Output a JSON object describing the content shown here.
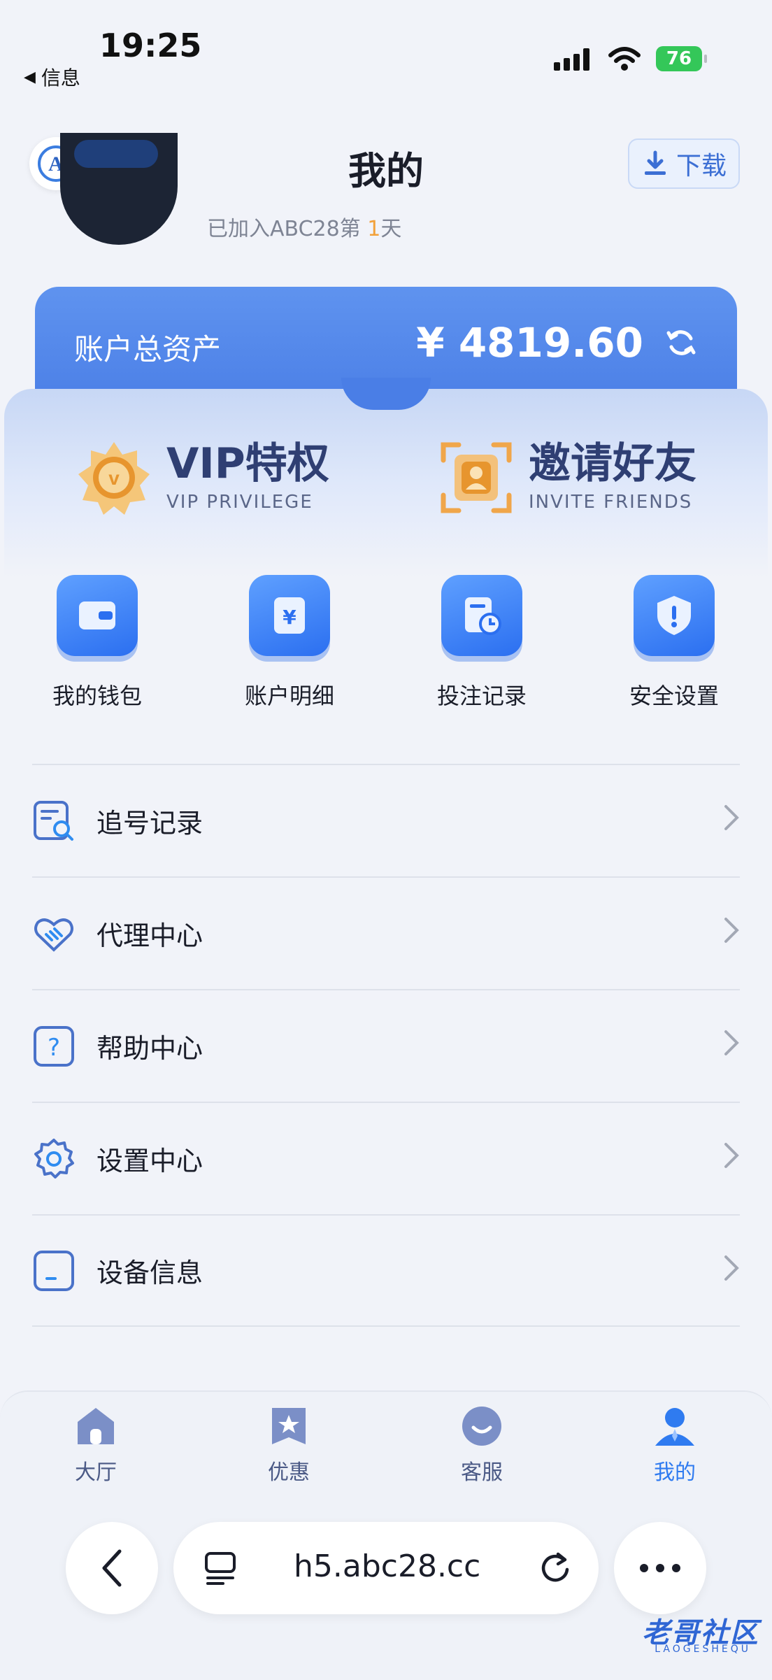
{
  "status_bar": {
    "time": "19:25",
    "back_app": "信息",
    "battery": "76"
  },
  "header": {
    "title": "我的",
    "download_label": "下载"
  },
  "profile": {
    "join_prefix": "已加入ABC28第 ",
    "join_days": "1",
    "join_suffix": "天"
  },
  "asset": {
    "label": "账户总资产",
    "value": "¥ 4819.60"
  },
  "privileges": [
    {
      "title": "VIP特权",
      "subtitle": "VIP PRIVILEGE"
    },
    {
      "title": "邀请好友",
      "subtitle": "INVITE FRIENDS"
    }
  ],
  "quick_actions": [
    {
      "label": "我的钱包",
      "icon": "wallet-icon"
    },
    {
      "label": "账户明细",
      "icon": "bill-icon"
    },
    {
      "label": "投注记录",
      "icon": "record-icon"
    },
    {
      "label": "安全设置",
      "icon": "shield-icon"
    }
  ],
  "menu": [
    {
      "label": "追号记录",
      "icon": "search-record-icon"
    },
    {
      "label": "代理中心",
      "icon": "handshake-heart-icon"
    },
    {
      "label": "帮助中心",
      "icon": "help-icon"
    },
    {
      "label": "设置中心",
      "icon": "gear-icon"
    },
    {
      "label": "设备信息",
      "icon": "device-icon"
    }
  ],
  "tabs": [
    {
      "label": "大厅",
      "icon": "home-icon",
      "active": false
    },
    {
      "label": "优惠",
      "icon": "bookmark-star-icon",
      "active": false
    },
    {
      "label": "客服",
      "icon": "smile-icon",
      "active": false
    },
    {
      "label": "我的",
      "icon": "user-icon",
      "active": true
    }
  ],
  "browser": {
    "url": "h5.abc28.cc"
  },
  "watermark": {
    "text": "老哥社区",
    "sub": "LAOGESHEQU"
  },
  "colors": {
    "accent": "#4a7ee6",
    "active_tab": "#2f7bf0",
    "gold": "#f2a13a"
  }
}
